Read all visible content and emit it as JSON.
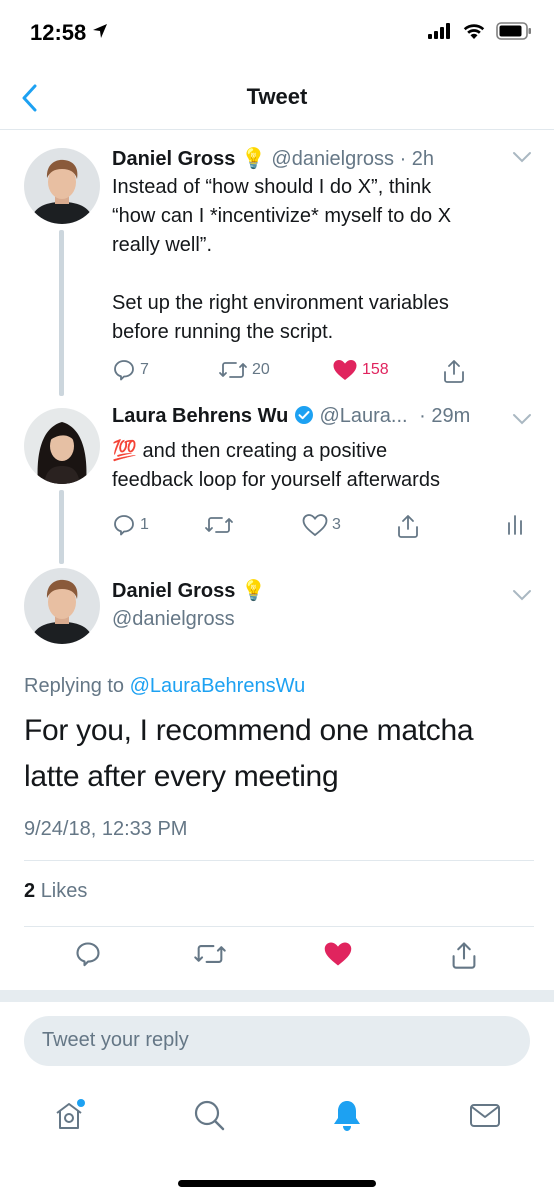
{
  "status": {
    "time": "12:58"
  },
  "nav": {
    "title": "Tweet"
  },
  "thread": [
    {
      "name": "Daniel Gross",
      "emoji": "💡",
      "handle": "@danielgross",
      "time": "· 2h",
      "text_lines": [
        "Instead of “how should I do X”, think",
        "“how can I *incentivize* myself to do X",
        "really well”.",
        "",
        "Set up the right environment variables",
        "before running the script."
      ],
      "replies": "7",
      "retweets": "20",
      "likes": "158",
      "liked": true
    },
    {
      "name": "Laura Behrens Wu",
      "handle": "@Laura...",
      "time": "· 29m",
      "emoji_prefix": "💯",
      "text_lines": [
        "and then creating a positive",
        "feedback loop for yourself afterwards"
      ],
      "replies": "1",
      "retweets": "",
      "likes": "3",
      "liked": false
    }
  ],
  "focus": {
    "name": "Daniel Gross",
    "emoji": "💡",
    "handle": "@danielgross",
    "replying_label": "Replying to",
    "replying_to": "@LauraBehrensWu",
    "text": "For you, I recommend one matcha latte after every meeting",
    "date": "9/24/18, 12:33 PM",
    "likes_count": "2",
    "likes_label": "Likes"
  },
  "reply": {
    "placeholder": "Tweet your reply"
  },
  "colors": {
    "accent": "#1da1f2",
    "like": "#e0245e",
    "muted": "#657786"
  }
}
